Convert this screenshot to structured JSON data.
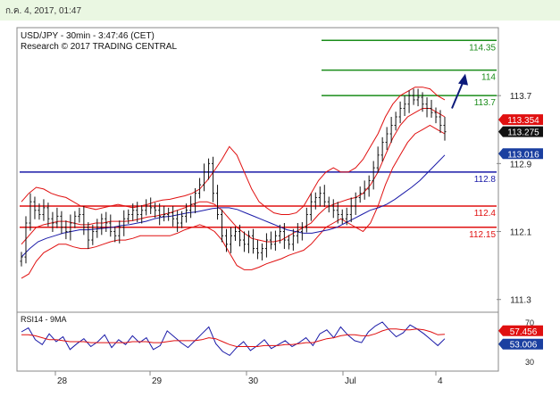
{
  "header": {
    "timestamp": "ก.ค. 4, 2017, 01:47"
  },
  "chart_data": {
    "type": "line",
    "title": "USD/JPY - 30min - 3:47:46 (CET)",
    "subtitle": "Research © 2017 TRADING CENTRAL",
    "x_labels": [
      "28",
      "29",
      "30",
      "Jul",
      "4"
    ],
    "price_axis": {
      "ylim": [
        111.15,
        114.5
      ],
      "ticks": [
        "113.7",
        "112.9",
        "112.1",
        "111.3"
      ]
    },
    "levels": [
      {
        "value": 114.35,
        "label": "114.35",
        "color": "#1a8c1a"
      },
      {
        "value": 114.0,
        "label": "114",
        "color": "#1a8c1a"
      },
      {
        "value": 113.7,
        "label": "113.7",
        "color": "#1a8c1a"
      },
      {
        "value": 112.8,
        "label": "112.8",
        "color": "#1a1aa8"
      },
      {
        "value": 112.4,
        "label": "112.4",
        "color": "#e01010"
      },
      {
        "value": 112.15,
        "label": "112.15",
        "color": "#e01010"
      }
    ],
    "badges": [
      {
        "value": 113.354,
        "label": "113.354",
        "color": "#e01010"
      },
      {
        "value": 113.275,
        "label": "113.275",
        "color": "#111111"
      },
      {
        "value": 113.016,
        "label": "113.016",
        "color": "#1a3fa0"
      }
    ],
    "price_close": [
      111.8,
      112.2,
      112.45,
      112.35,
      112.3,
      112.38,
      112.25,
      112.2,
      112.28,
      112.15,
      112.1,
      112.2,
      112.28,
      112.3,
      112.15,
      112.0,
      112.1,
      112.15,
      112.25,
      112.2,
      112.1,
      112.05,
      112.15,
      112.25,
      112.3,
      112.35,
      112.3,
      112.35,
      112.4,
      112.38,
      112.35,
      112.28,
      112.3,
      112.32,
      112.25,
      112.2,
      112.28,
      112.35,
      112.42,
      112.55,
      112.65,
      112.8,
      112.9,
      112.55,
      112.3,
      112.05,
      111.95,
      112.05,
      112.1,
      112.0,
      111.95,
      112.05,
      111.9,
      111.85,
      111.9,
      112.0,
      111.95,
      112.05,
      112.1,
      112.0,
      111.95,
      112.05,
      112.1,
      112.15,
      112.3,
      112.45,
      112.5,
      112.55,
      112.45,
      112.4,
      112.35,
      112.3,
      112.25,
      112.3,
      112.4,
      112.5,
      112.55,
      112.6,
      112.7,
      112.85,
      113.0,
      113.15,
      113.25,
      113.35,
      113.45,
      113.55,
      113.6,
      113.7,
      113.65,
      113.68,
      113.6,
      113.55,
      113.5,
      113.45,
      113.35,
      113.275
    ],
    "bollinger": {
      "upper": [
        112.45,
        112.55,
        112.62,
        112.6,
        112.55,
        112.52,
        112.5,
        112.45,
        112.4,
        112.38,
        112.36,
        112.38,
        112.4,
        112.42,
        112.4,
        112.38,
        112.4,
        112.42,
        112.45,
        112.47,
        112.48,
        112.5,
        112.52,
        112.55,
        112.6,
        112.7,
        112.82,
        112.95,
        113.1,
        113.0,
        112.8,
        112.6,
        112.45,
        112.38,
        112.32,
        112.3,
        112.3,
        112.32,
        112.4,
        112.55,
        112.7,
        112.8,
        112.85,
        112.8,
        112.8,
        112.85,
        112.95,
        113.1,
        113.25,
        113.45,
        113.6,
        113.7,
        113.75,
        113.8,
        113.8,
        113.78,
        113.7,
        113.65
      ],
      "lower": [
        111.55,
        111.6,
        111.75,
        111.85,
        111.9,
        111.95,
        111.95,
        111.92,
        111.9,
        111.9,
        111.92,
        111.95,
        111.98,
        112.0,
        112.0,
        112.02,
        112.05,
        112.05,
        112.05,
        112.05,
        112.05,
        112.08,
        112.12,
        112.15,
        112.18,
        112.15,
        112.1,
        112.0,
        111.85,
        111.7,
        111.65,
        111.65,
        111.68,
        111.72,
        111.75,
        111.78,
        111.82,
        111.85,
        111.88,
        111.95,
        112.05,
        112.15,
        112.2,
        112.25,
        112.2,
        112.15,
        112.1,
        112.2,
        112.4,
        112.65,
        112.85,
        113.0,
        113.15,
        113.25,
        113.3,
        113.35,
        113.3,
        113.25
      ],
      "middle": [
        111.95,
        112.05,
        112.15,
        112.18,
        112.2,
        112.22,
        112.22,
        112.2,
        112.18,
        112.18,
        112.2,
        112.2,
        112.22,
        112.22,
        112.22,
        112.23,
        112.25,
        112.27,
        112.28,
        112.3,
        112.32,
        112.35,
        112.38,
        112.42,
        112.45,
        112.45,
        112.42,
        112.35,
        112.25,
        112.15,
        112.08,
        112.02,
        112.0,
        111.98,
        111.98,
        112.0,
        112.05,
        112.1,
        112.15,
        112.2,
        112.3,
        112.38,
        112.42,
        112.45,
        112.48,
        112.5,
        112.55,
        112.65,
        112.8,
        113.0,
        113.2,
        113.35,
        113.45,
        113.5,
        113.55,
        113.55,
        113.5,
        113.45
      ]
    },
    "ma_blue": [
      111.8,
      111.9,
      111.98,
      112.02,
      112.05,
      112.08,
      112.1,
      112.12,
      112.12,
      112.13,
      112.14,
      112.15,
      112.17,
      112.18,
      112.2,
      112.22,
      112.25,
      112.27,
      112.28,
      112.3,
      112.32,
      112.33,
      112.35,
      112.37,
      112.38,
      112.38,
      112.36,
      112.32,
      112.28,
      112.24,
      112.2,
      112.16,
      112.12,
      112.1,
      112.08,
      112.08,
      112.1,
      112.12,
      112.15,
      112.2,
      112.25,
      112.3,
      112.35,
      112.38,
      112.42,
      112.48,
      112.55,
      112.62,
      112.7,
      112.8,
      112.9,
      113.0
    ],
    "arrow": {
      "from": 113.55,
      "to": 114.0
    },
    "rsi": {
      "title": "RSI14 - 9MA",
      "ylim": [
        30,
        70
      ],
      "ticks": [
        "70",
        "30"
      ],
      "rsi_values": [
        60,
        64,
        52,
        47,
        58,
        50,
        55,
        42,
        48,
        53,
        45,
        50,
        57,
        44,
        52,
        47,
        56,
        49,
        54,
        42,
        46,
        61,
        55,
        49,
        44,
        51,
        58,
        65,
        48,
        40,
        36,
        44,
        50,
        41,
        46,
        52,
        43,
        47,
        51,
        45,
        49,
        54,
        46,
        58,
        62,
        54,
        65,
        57,
        51,
        49,
        60,
        66,
        70,
        62,
        55,
        59,
        67,
        63,
        58,
        52,
        46,
        53.006
      ],
      "ma_values": [
        57,
        57,
        56,
        54,
        52,
        52,
        51,
        50,
        50,
        50,
        49,
        49,
        49,
        49,
        49,
        49,
        50,
        50,
        50,
        49,
        49,
        50,
        51,
        51,
        51,
        51,
        52,
        54,
        53,
        50,
        47,
        45,
        45,
        45,
        45,
        46,
        46,
        46,
        47,
        47,
        48,
        49,
        49,
        51,
        53,
        54,
        56,
        57,
        57,
        56,
        56,
        58,
        61,
        63,
        63,
        62,
        62,
        63,
        62,
        60,
        57,
        57.456
      ],
      "badges": [
        {
          "value": 57.456,
          "label": "57.456",
          "color": "#e01010"
        },
        {
          "value": 53.006,
          "label": "53.006",
          "color": "#1a3fa0"
        }
      ]
    }
  }
}
